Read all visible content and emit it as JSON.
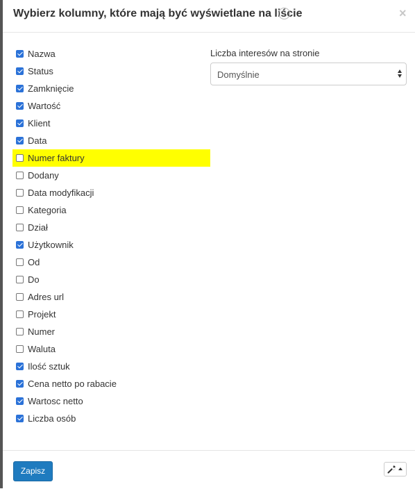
{
  "dialog": {
    "title": "Wybierz kolumny, które mają być wyświetlane na liście",
    "help_icon": "question-circle-icon",
    "help_glyph": "?",
    "close_icon": "close-icon",
    "close_glyph": "×"
  },
  "columns": [
    {
      "label": "Nazwa",
      "checked": true
    },
    {
      "label": "Status",
      "checked": true
    },
    {
      "label": "Zamknięcie",
      "checked": true
    },
    {
      "label": "Wartość",
      "checked": true
    },
    {
      "label": "Klient",
      "checked": true
    },
    {
      "label": "Data",
      "checked": true
    },
    {
      "label": "Numer faktury",
      "checked": false,
      "highlighted": true
    },
    {
      "label": "Dodany",
      "checked": false
    },
    {
      "label": "Data modyfikacji",
      "checked": false
    },
    {
      "label": "Kategoria",
      "checked": false
    },
    {
      "label": "Dział",
      "checked": false
    },
    {
      "label": "Użytkownik",
      "checked": true
    },
    {
      "label": "Od",
      "checked": false
    },
    {
      "label": "Do",
      "checked": false
    },
    {
      "label": "Adres url",
      "checked": false
    },
    {
      "label": "Projekt",
      "checked": false
    },
    {
      "label": "Numer",
      "checked": false
    },
    {
      "label": "Waluta",
      "checked": false
    },
    {
      "label": "Ilość sztuk",
      "checked": true
    },
    {
      "label": "Cena netto po rabacie",
      "checked": true
    },
    {
      "label": "Wartosc netto",
      "checked": true
    },
    {
      "label": "Liczba osób",
      "checked": true
    }
  ],
  "per_page": {
    "label": "Liczba interesów na stronie",
    "selected": "Domyślnie"
  },
  "footer": {
    "save_label": "Zapisz",
    "tools_icon": "wrench-icon"
  },
  "colors": {
    "checkbox_checked": "#2b72d8",
    "highlight": "#ffff00",
    "primary_button": "#1f7bbf"
  }
}
